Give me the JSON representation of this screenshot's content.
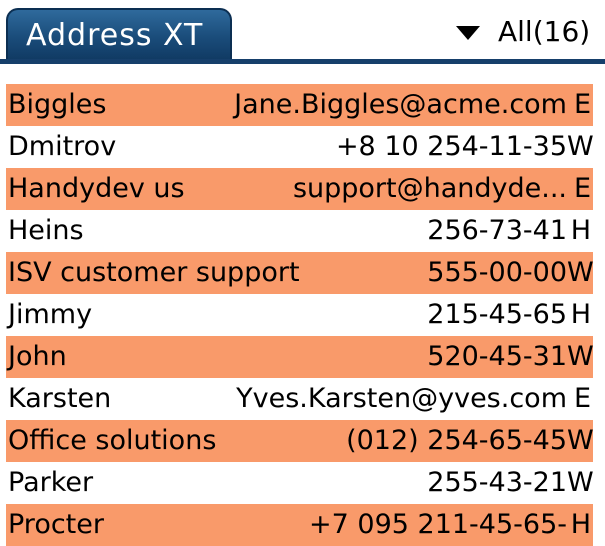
{
  "header": {
    "app_title": "Address XT",
    "category": "All(16)"
  },
  "contacts": [
    {
      "name": "Biggles",
      "value": "Jane.Biggles@acme.com",
      "type": "E"
    },
    {
      "name": "Dmitrov",
      "value": "+8 10 254-11-35",
      "type": "W"
    },
    {
      "name": "Handydev us",
      "value": "support@handyde...",
      "type": "E"
    },
    {
      "name": "Heins",
      "value": "256-73-41",
      "type": "H"
    },
    {
      "name": "ISV customer support",
      "value": "555-00-00",
      "type": "W"
    },
    {
      "name": "Jimmy",
      "value": "215-45-65",
      "type": "H"
    },
    {
      "name": "John",
      "value": "520-45-31",
      "type": "W"
    },
    {
      "name": "Karsten",
      "value": "Yves.Karsten@yves.com",
      "type": "E"
    },
    {
      "name": "Office solutions",
      "value": "(012) 254-65-45",
      "type": "W"
    },
    {
      "name": "Parker",
      "value": "255-43-21",
      "type": "W"
    },
    {
      "name": "Procter",
      "value": "+7 095 211-45-65-",
      "type": "H"
    }
  ],
  "colors": {
    "row_highlight": "#f99a6a",
    "title_tab": "#1a4c7a",
    "title_rule": "#163f6b"
  },
  "icons": {
    "category_dropdown": "triangle-down-icon"
  }
}
